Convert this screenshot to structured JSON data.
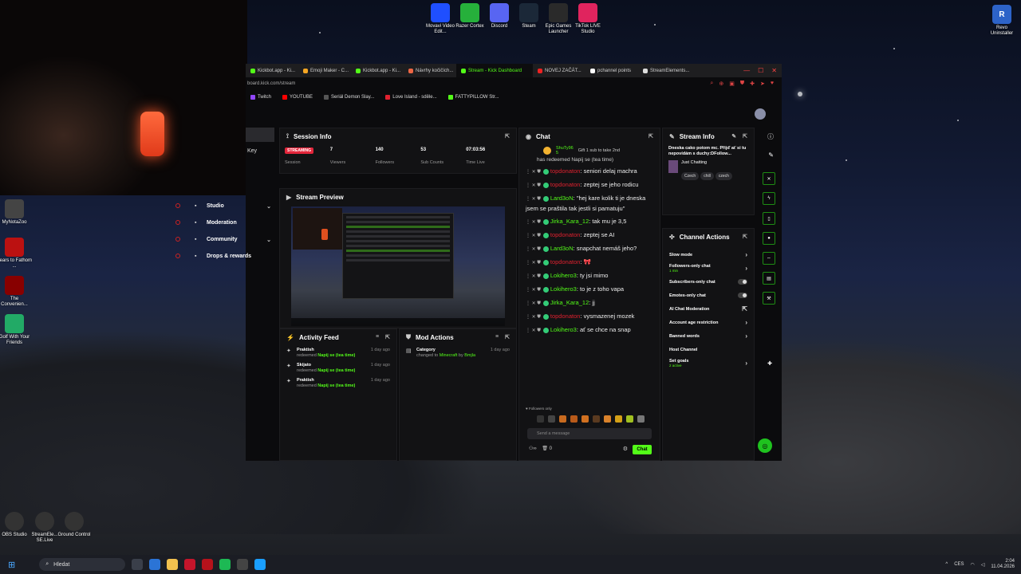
{
  "desktop": {
    "top_icons": [
      {
        "label": "Movavi Video Edit...",
        "icon": "movavi-icon",
        "color": "#1f4fff"
      },
      {
        "label": "Razer Cortex",
        "icon": "razer-icon",
        "color": "#26b03b"
      },
      {
        "label": "Discord",
        "icon": "discord-icon",
        "color": "#5865f2"
      },
      {
        "label": "Steam",
        "icon": "steam-icon",
        "color": "#1b2838"
      },
      {
        "label": "Epic Games Launcher",
        "icon": "epic-icon",
        "color": "#2a2a2a"
      },
      {
        "label": "TikTok LIVE Studio",
        "icon": "tiktok-icon",
        "color": "#e0245e"
      }
    ],
    "right_icon": {
      "label": "Revo Uninstaller",
      "icon": "revo-icon"
    },
    "left_icons": [
      {
        "label": "MyNotaZoo",
        "icon": "app-icon",
        "color": "#444"
      },
      {
        "label": "Fears to Fathom ...",
        "icon": "f2f-icon",
        "color": "#b11"
      },
      {
        "label": "The Convenien...",
        "icon": "game-icon",
        "color": "#800"
      },
      {
        "label": "Golf With Your Friends",
        "icon": "golf-icon",
        "color": "#2a6"
      }
    ],
    "bottom_icons": [
      {
        "label": "OBS Studio",
        "icon": "obs-icon"
      },
      {
        "label": "StreamEle... SE.Live",
        "icon": "streamelements-icon"
      },
      {
        "label": "Ground Control",
        "icon": "ground-control-icon"
      }
    ]
  },
  "browser": {
    "tabs": [
      {
        "label": "Kickbot.app - Ki..."
      },
      {
        "label": "Emoji Maker - C..."
      },
      {
        "label": "Kickbot.app - Ki..."
      },
      {
        "label": "Návrhy kočičích..."
      },
      {
        "label": "Stream - Kick Dashboard",
        "active": true
      },
      {
        "label": "NOVEJ ZAČÁT..."
      },
      {
        "label": "pchannel points"
      },
      {
        "label": "StreamElements..."
      }
    ],
    "url": "board.kick.com/stream",
    "bookmarks": [
      {
        "label": "Twitch",
        "color": "#9146ff"
      },
      {
        "label": "YOUTUBE",
        "color": "#ff0000"
      },
      {
        "label": "Seriál Demon Slay...",
        "color": "#555"
      },
      {
        "label": "Love Island - sděle...",
        "color": "#e0212f"
      },
      {
        "label": "FATTYPILLOW Str...",
        "color": "#53fc18"
      }
    ]
  },
  "dashboard": {
    "key_label": "Key",
    "nav": [
      {
        "label": "Studio",
        "icon": "video-icon",
        "has_chevron": true
      },
      {
        "label": "Moderation",
        "icon": "shield-icon"
      },
      {
        "label": "Community",
        "icon": "users-icon",
        "has_chevron": true
      },
      {
        "label": "Drops & rewards",
        "icon": "gift-icon"
      }
    ],
    "session_info": {
      "title": "Session Info",
      "stats": [
        {
          "value": "STREAMING",
          "label": "Session",
          "is_badge": true
        },
        {
          "value": "7",
          "label": "Viewers"
        },
        {
          "value": "140",
          "label": "Followers"
        },
        {
          "value": "53",
          "label": "Sub Counts"
        },
        {
          "value": "07:03:56",
          "label": "Time Live"
        }
      ]
    },
    "stream_preview": {
      "title": "Stream Preview"
    },
    "activity_feed": {
      "title": "Activity Feed",
      "items": [
        {
          "name": "Praktish",
          "action": "redeemed",
          "reward": "Napij se (tea time)",
          "time": "1 day ago"
        },
        {
          "name": "Skijato",
          "action": "redeemed",
          "reward": "Napij se (tea time)",
          "time": "1 day ago"
        },
        {
          "name": "Praktish",
          "action": "redeemed",
          "reward": "Napij se (tea time)",
          "time": "1 day ago"
        }
      ]
    },
    "mod_actions": {
      "title": "Mod Actions",
      "items": [
        {
          "name": "Category",
          "detail_prefix": "changed to",
          "detail_value": "Minecraft",
          "detail_mid": "by",
          "detail_user": "Bmjla",
          "time": "1 day ago"
        }
      ]
    },
    "chat": {
      "title": "Chat",
      "pinned_user": "ShuTy96",
      "pinned_count": "5",
      "pinned_text": "Gift 1 sub to take 2nd",
      "cut_line": "has redeemed Napij se (tea time)",
      "messages": [
        {
          "user": "topdonaton",
          "color": "red",
          "text": "seniori delaj machra"
        },
        {
          "user": "topdonaton",
          "color": "red",
          "text": "zeptej se jeho rodicu"
        },
        {
          "user": "Lard3oN",
          "color": "green",
          "text": "\"hej kare kolik ti je dneska jsem se praštila tak jestli si pamatuju\""
        },
        {
          "user": "Jirka_Kara_12",
          "color": "green",
          "text": "tak mu je 3,5"
        },
        {
          "user": "topdonaton",
          "color": "red",
          "text": "zeptej se AI"
        },
        {
          "user": "Lard3oN",
          "color": "green",
          "text": "snapchat nemáš jeho?"
        },
        {
          "user": "topdonaton",
          "color": "red",
          "text": "🎀"
        },
        {
          "user": "Lokihero3",
          "color": "green",
          "text": "ty jsi mimo"
        },
        {
          "user": "Lokihero3",
          "color": "green",
          "text": "to je z toho vapa"
        },
        {
          "user": "Jirka_Kara_12",
          "color": "green",
          "text": "jj"
        },
        {
          "user": "topdonaton",
          "color": "red",
          "text": "vysmazenej mozek"
        },
        {
          "user": "Lokihero3",
          "color": "green",
          "text": "ať se chce na snap"
        }
      ],
      "followers_only_label": "Followers only",
      "input_placeholder": "Send a message",
      "footer_count": "0",
      "send_label": "Chat"
    },
    "stream_info": {
      "title": "Stream Info",
      "stream_title": "Dneska cako potom mc. Přijď ať si tu nepovídám s duchy:DFollow...",
      "category": "Just Chatting",
      "tags": [
        "Czech",
        "chill",
        "czech"
      ]
    },
    "channel_actions": {
      "title": "Channel Actions",
      "items": [
        {
          "label": "Slow mode",
          "control": "chevron"
        },
        {
          "label": "Followers-only chat",
          "sub": "1 min",
          "control": "chevron"
        },
        {
          "label": "Subscribers-only chat",
          "control": "toggle"
        },
        {
          "label": "Emotes-only chat",
          "control": "toggle"
        },
        {
          "label": "AI Chat Moderation",
          "control": "external"
        },
        {
          "label": "Account age restriction",
          "control": "chevron"
        },
        {
          "label": "Banned words",
          "control": "chevron"
        },
        {
          "label": "Host Channel",
          "control": "none"
        },
        {
          "label": "Set goals",
          "sub": "2 active",
          "control": "chevron"
        }
      ]
    }
  },
  "taskbar": {
    "search_placeholder": "Hledat",
    "tray_lang": "CES",
    "time": "2:04",
    "date": "11.04.2026"
  },
  "colors": {
    "kick_green": "#53fc18",
    "live_red": "#e3263b"
  }
}
